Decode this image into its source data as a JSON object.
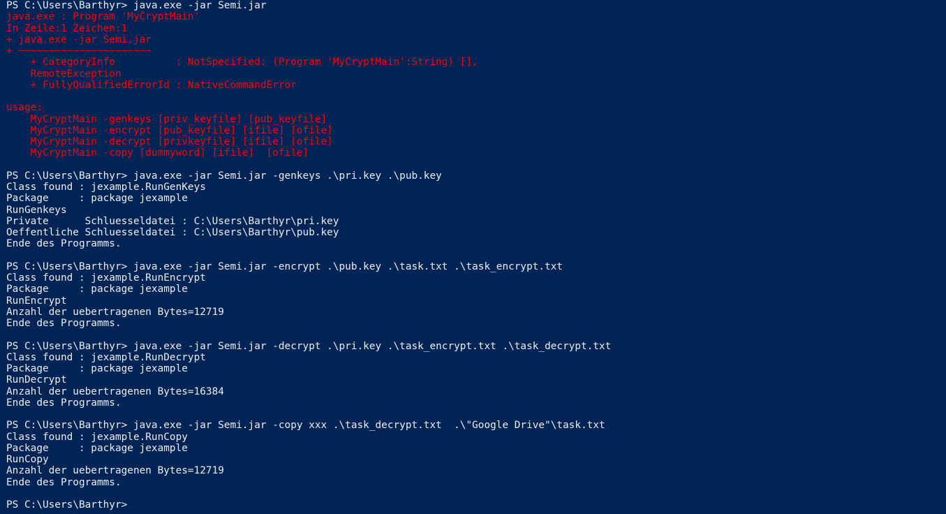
{
  "window": {
    "background": "#012456",
    "normal_color": "#eeedf0",
    "error_color": "#ff0000"
  },
  "lines": [
    {
      "kind": "normal",
      "text": "PS C:\\Users\\Barthyr> java.exe -jar Semi.jar"
    },
    {
      "kind": "error",
      "text": "java.exe : Program 'MyCryptMain'"
    },
    {
      "kind": "error",
      "text": "In Zeile:1 Zeichen:1"
    },
    {
      "kind": "error",
      "text": "+ java.exe -jar Semi.jar"
    },
    {
      "kind": "error",
      "text": "+ ~~~~~~~~~~~~~~~~~~~~~~"
    },
    {
      "kind": "error",
      "text": "    + CategoryInfo          : NotSpecified: (Program 'MyCryptMain':String) [],"
    },
    {
      "kind": "error",
      "text": "    RemoteException"
    },
    {
      "kind": "error",
      "text": "    + FullyQualifiedErrorId : NativeCommandError"
    },
    {
      "kind": "blank",
      "text": ""
    },
    {
      "kind": "error",
      "text": "usage:"
    },
    {
      "kind": "error",
      "text": "    MyCryptMain -genkeys [priv_keyfile] [pub_keyfile]"
    },
    {
      "kind": "error",
      "text": "    MyCryptMain -encrypt [pub_keyfile] [ifile] [ofile]"
    },
    {
      "kind": "error",
      "text": "    MyCryptMain -decrypt [privkeyfile] [ifile] [ofile]"
    },
    {
      "kind": "error",
      "text": "    MyCryptMain -copy [dummyword] [ifile]  [ofile]"
    },
    {
      "kind": "blank",
      "text": ""
    },
    {
      "kind": "normal",
      "text": "PS C:\\Users\\Barthyr> java.exe -jar Semi.jar -genkeys .\\pri.key .\\pub.key"
    },
    {
      "kind": "normal",
      "text": "Class found : jexample.RunGenKeys"
    },
    {
      "kind": "normal",
      "text": "Package     : package jexample"
    },
    {
      "kind": "normal",
      "text": "RunGenkeys"
    },
    {
      "kind": "normal",
      "text": "Private      Schluesseldatei : C:\\Users\\Barthyr\\pri.key"
    },
    {
      "kind": "normal",
      "text": "Oeffentliche Schluesseldatei : C:\\Users\\Barthyr\\pub.key"
    },
    {
      "kind": "normal",
      "text": "Ende des Programms."
    },
    {
      "kind": "blank",
      "text": ""
    },
    {
      "kind": "normal",
      "text": "PS C:\\Users\\Barthyr> java.exe -jar Semi.jar -encrypt .\\pub.key .\\task.txt .\\task_encrypt.txt"
    },
    {
      "kind": "normal",
      "text": "Class found : jexample.RunEncrypt"
    },
    {
      "kind": "normal",
      "text": "Package     : package jexample"
    },
    {
      "kind": "normal",
      "text": "RunEncrypt"
    },
    {
      "kind": "normal",
      "text": "Anzahl der uebertragenen Bytes=12719"
    },
    {
      "kind": "normal",
      "text": "Ende des Programms."
    },
    {
      "kind": "blank",
      "text": ""
    },
    {
      "kind": "normal",
      "text": "PS C:\\Users\\Barthyr> java.exe -jar Semi.jar -decrypt .\\pri.key .\\task_encrypt.txt .\\task_decrypt.txt"
    },
    {
      "kind": "normal",
      "text": "Class found : jexample.RunDecrypt"
    },
    {
      "kind": "normal",
      "text": "Package     : package jexample"
    },
    {
      "kind": "normal",
      "text": "RunDecrypt"
    },
    {
      "kind": "normal",
      "text": "Anzahl der uebertragenen Bytes=16384"
    },
    {
      "kind": "normal",
      "text": "Ende des Programms."
    },
    {
      "kind": "blank",
      "text": ""
    },
    {
      "kind": "normal",
      "text": "PS C:\\Users\\Barthyr> java.exe -jar Semi.jar -copy xxx .\\task_decrypt.txt  .\\\"Google Drive\"\\task.txt"
    },
    {
      "kind": "normal",
      "text": "Class found : jexample.RunCopy"
    },
    {
      "kind": "normal",
      "text": "Package     : package jexample"
    },
    {
      "kind": "normal",
      "text": "RunCopy"
    },
    {
      "kind": "normal",
      "text": "Anzahl der uebertragenen Bytes=12719"
    },
    {
      "kind": "normal",
      "text": "Ende des Programms."
    },
    {
      "kind": "blank",
      "text": ""
    },
    {
      "kind": "normal",
      "text": "PS C:\\Users\\Barthyr> "
    }
  ]
}
